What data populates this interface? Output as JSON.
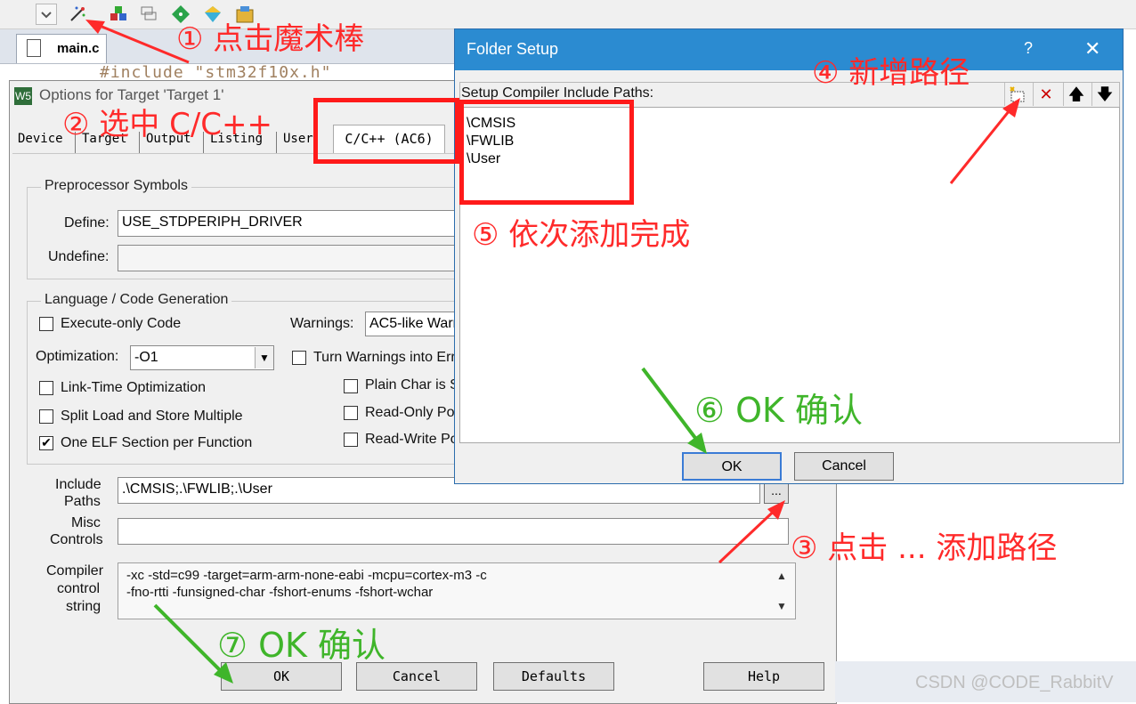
{
  "ide": {
    "file_tab": "main.c",
    "code_snippet": "#include \"stm32f10x.h\""
  },
  "options_dialog": {
    "title": "Options for Target 'Target 1'",
    "app_icon": "W5",
    "tabs": [
      "Device",
      "Target",
      "Output",
      "Listing",
      "User",
      "C/C++ (AC6)"
    ],
    "preprocessor": {
      "group_label": "Preprocessor Symbols",
      "define_label": "Define:",
      "define_value": "USE_STDPERIPH_DRIVER",
      "undefine_label": "Undefine:",
      "undefine_value": ""
    },
    "language": {
      "group_label": "Language / Code Generation",
      "execute_only": "Execute-only Code",
      "warnings_label": "Warnings:",
      "warnings_value": "AC5-like Warn",
      "optimization_label": "Optimization:",
      "optimization_value": "-O1",
      "turn_warnings": "Turn Warnings into Err",
      "link_time": "Link-Time Optimization",
      "plain_char": "Plain Char is S",
      "split_load": "Split Load and Store Multiple",
      "read_only": "Read-Only Po",
      "one_elf": "One ELF Section per Function",
      "read_write": "Read-Write Po"
    },
    "include_paths_label_1": "Include",
    "include_paths_label_2": "Paths",
    "include_paths_value": ".\\CMSIS;.\\FWLIB;.\\User",
    "browse_label": "...",
    "misc_label_1": "Misc",
    "misc_label_2": "Controls",
    "misc_value": "",
    "compiler_label_1": "Compiler",
    "compiler_label_2": "control",
    "compiler_label_3": "string",
    "compiler_line_1": "-xc -std=c99 -target=arm-arm-none-eabi -mcpu=cortex-m3 -c",
    "compiler_line_2": "-fno-rtti -funsigned-char -fshort-enums -fshort-wchar",
    "buttons": {
      "ok": "OK",
      "cancel": "Cancel",
      "defaults": "Defaults",
      "help": "Help"
    },
    "checks": {
      "execute_only": false,
      "turn_warnings": false,
      "link_time": false,
      "plain_char": false,
      "split_load": false,
      "read_only": false,
      "one_elf": true,
      "read_write": false
    }
  },
  "folder_setup": {
    "title": "Folder Setup",
    "help": "?",
    "close": "✕",
    "header_label": "Setup Compiler Include Paths:",
    "paths": [
      "\\CMSIS",
      "\\FWLIB",
      "\\User"
    ],
    "buttons": {
      "ok": "OK",
      "cancel": "Cancel"
    },
    "icons": [
      "new-folder-icon",
      "delete-icon",
      "move-up-icon",
      "move-down-icon"
    ]
  },
  "annotations": {
    "step1": "① 点击魔术棒",
    "step2": "② 选中 C/C++",
    "step3": "③ 点击 ... 添加路径",
    "step4": "④ 新增路径",
    "step5": "⑤ 依次添加完成",
    "step6": "⑥ OK 确认",
    "step7": "⑦ OK 确认"
  },
  "watermark": "CSDN @CODE_RabbitV",
  "colors": {
    "annotation_red": "#ff2a2a",
    "annotation_green": "#3fb52a",
    "title_blue": "#2b8bd1"
  }
}
